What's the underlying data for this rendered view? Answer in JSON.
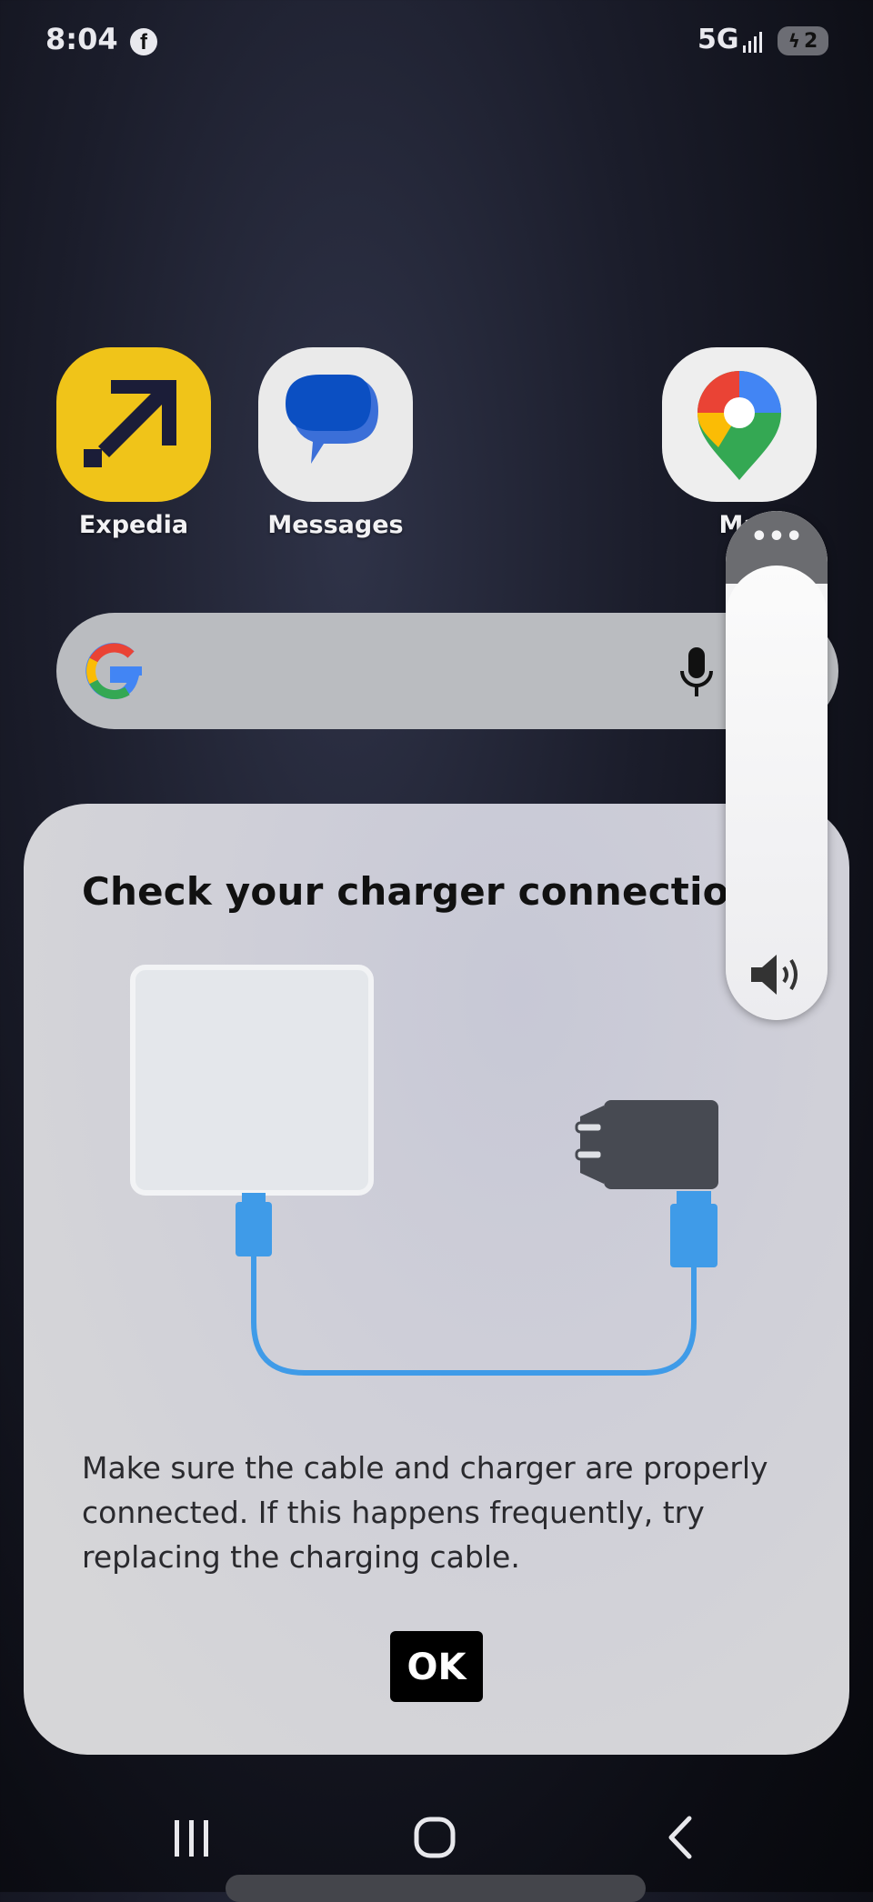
{
  "status_bar": {
    "time": "8:04",
    "network": "5G",
    "battery_level": "2",
    "notification_icons": [
      "facebook-icon"
    ]
  },
  "apps": [
    {
      "name": "Expedia",
      "icon": "expedia-icon",
      "color": "#f0c419"
    },
    {
      "name": "Messages",
      "icon": "messages-icon",
      "color": "#1a56c7"
    },
    {
      "name": "Ma",
      "icon": "maps-icon",
      "color": "#34a853"
    }
  ],
  "search": {
    "logo": "google-g-icon",
    "voice_icon": "mic-icon"
  },
  "volume_panel": {
    "more_label": "•••",
    "icon": "speaker-icon"
  },
  "dialog": {
    "title": "Check your charger connection",
    "body": "Make sure the cable and charger are properly connected. If this happens frequently, try replacing the charging cable.",
    "ok_label": "OK",
    "cable_color": "#3f9be8",
    "charger_color": "#474a52"
  },
  "nav": {
    "recents_icon": "recents-icon",
    "home_icon": "home-icon",
    "back_icon": "back-icon"
  }
}
